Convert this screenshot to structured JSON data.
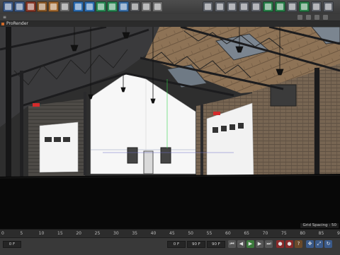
{
  "toolbar": {
    "icons": [
      {
        "name": "undo-icon",
        "color": "#3f5d8a"
      },
      {
        "name": "redo-icon",
        "color": "#3f5d8a"
      },
      {
        "name": "live-selection-icon",
        "color": "#8a3a2a"
      },
      {
        "name": "move-icon",
        "color": "#8a5a2a"
      },
      {
        "name": "scale-icon",
        "color": "#a06830"
      },
      {
        "name": "rotate-icon",
        "color": "#6a6a6a"
      },
      {
        "name": "cube-icon",
        "color": "#2e6db0"
      },
      {
        "name": "pen-icon",
        "color": "#2e6db0"
      },
      {
        "name": "subdivision-icon",
        "color": "#2b8a55"
      },
      {
        "name": "array-icon",
        "color": "#2b8a55"
      },
      {
        "name": "deformer-icon",
        "color": "#3a6ea5"
      },
      {
        "name": "floor-icon",
        "color": "#55575a"
      },
      {
        "name": "camera-icon",
        "color": "#6a6a6a"
      },
      {
        "name": "light-icon",
        "color": "#6f6f6f"
      }
    ],
    "right_icons": [
      {
        "name": "model-mode-icon",
        "color": "#5d6168"
      },
      {
        "name": "object-mode-icon",
        "color": "#5d6168"
      },
      {
        "name": "points-mode-icon",
        "color": "#5d6168"
      },
      {
        "name": "edges-mode-icon",
        "color": "#5d6168"
      },
      {
        "name": "polygons-mode-icon",
        "color": "#5d6168"
      },
      {
        "name": "axis-icon",
        "color": "#2a7f4a"
      },
      {
        "name": "tweak-icon",
        "color": "#2a7f4a"
      },
      {
        "name": "snap-icon",
        "color": "#5d6168"
      },
      {
        "name": "workplane-icon",
        "color": "#2a7f4a"
      },
      {
        "name": "locked-workplane-icon",
        "color": "#5d6168"
      },
      {
        "name": "render-view-icon",
        "color": "#5d6168"
      }
    ]
  },
  "viewport_title": "ProRender",
  "status": {
    "grid_spacing": "Grid Spacing : 50"
  },
  "timeline": {
    "ticks": [
      "0",
      "5",
      "10",
      "15",
      "20",
      "25",
      "30",
      "35",
      "40",
      "45",
      "50",
      "55",
      "60",
      "65",
      "70",
      "75",
      "80",
      "85",
      "90"
    ]
  },
  "controls": {
    "start_frame": "0 F",
    "current_frame": "0 F",
    "end_frame": "90 F",
    "end_frame2": "90 F"
  }
}
